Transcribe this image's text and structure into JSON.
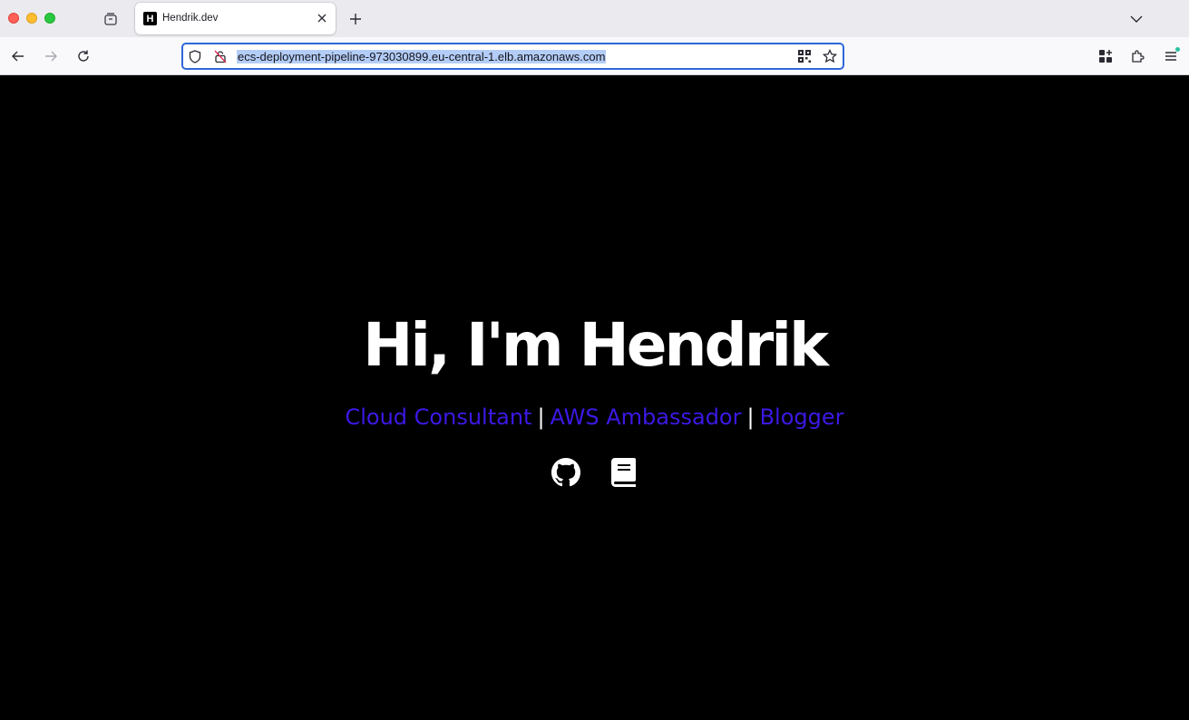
{
  "browser": {
    "tab": {
      "favicon_letter": "H",
      "title": "Hendrik.dev"
    },
    "url": "ecs-deployment-pipeline-973030899.eu-central-1.elb.amazonaws.com"
  },
  "hero": {
    "title": "Hi, I'm Hendrik",
    "roles": [
      "Cloud Consultant",
      "AWS Ambassador",
      "Blogger"
    ],
    "separator": "|"
  },
  "colors": {
    "role_link": "#3d18e6",
    "page_background": "#000000"
  },
  "social_icons": [
    "github-icon",
    "book-icon"
  ]
}
